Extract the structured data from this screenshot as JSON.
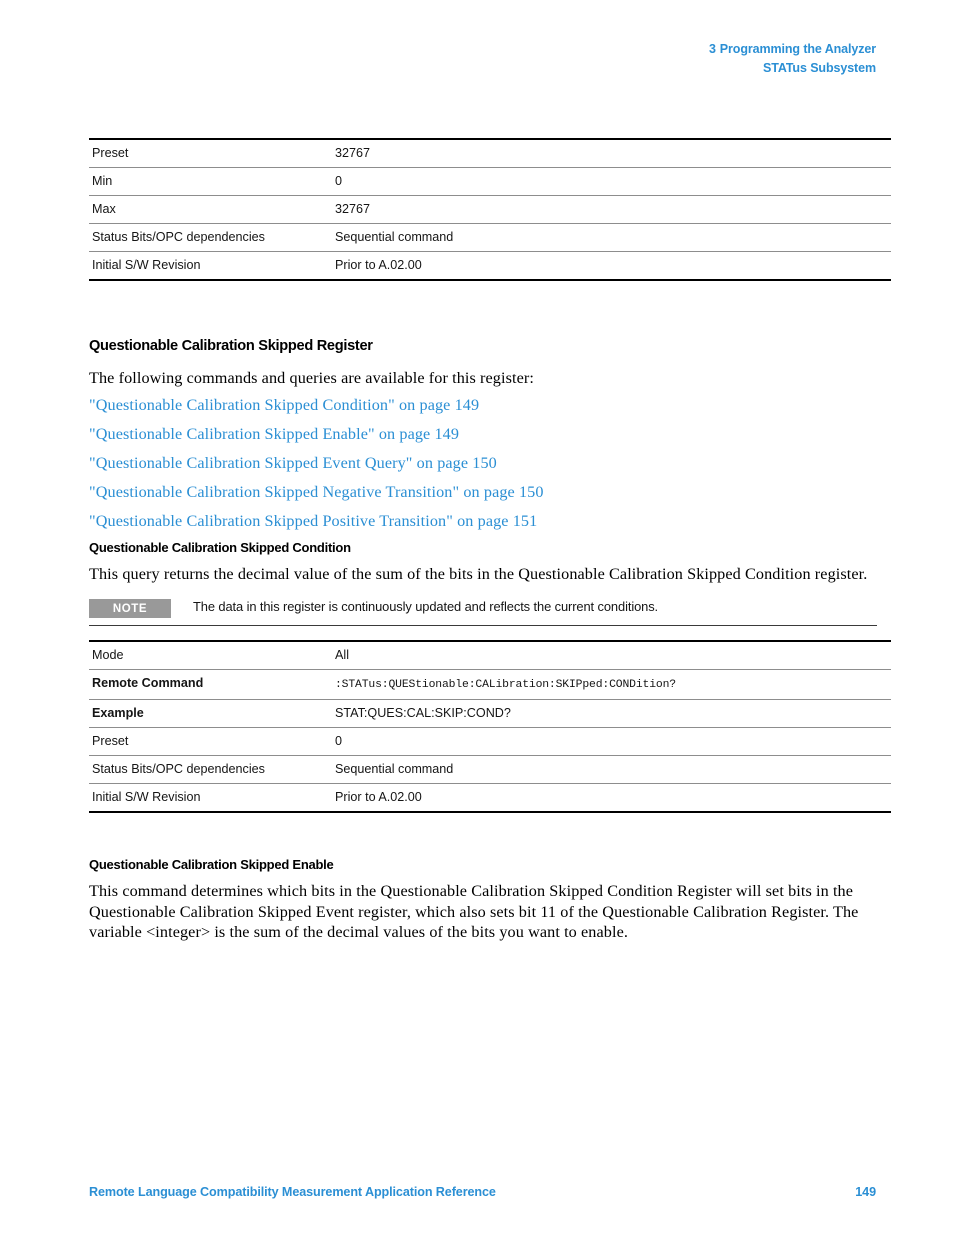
{
  "header": {
    "chapter_number": "3",
    "chapter_title": "Programming the Analyzer",
    "subsystem": "STATus Subsystem",
    "color": "#2b8fd4"
  },
  "top_table": {
    "rows": [
      {
        "key": "Preset",
        "value": "32767"
      },
      {
        "key": "Min",
        "value": "0"
      },
      {
        "key": "Max",
        "value": "32767"
      },
      {
        "key": "Status Bits/OPC dependencies",
        "value": "Sequential command"
      },
      {
        "key": "Initial S/W Revision",
        "value": "Prior to A.02.00"
      }
    ]
  },
  "register_section": {
    "heading": "Questionable Calibration Skipped Register",
    "intro": "The following commands and queries are available for this register:",
    "links": [
      "\"Questionable Calibration Skipped Condition\" on page 149",
      "\"Questionable Calibration Skipped Enable\" on page 149",
      "\"Questionable Calibration Skipped Event Query\" on page 150",
      "\"Questionable Calibration Skipped Negative Transition\" on page 150",
      "\"Questionable Calibration Skipped Positive Transition\" on page 151"
    ]
  },
  "condition_section": {
    "heading": "Questionable Calibration Skipped Condition",
    "description": "This query returns the decimal value of the sum of the bits in the Questionable Calibration Skipped Condition register.",
    "note": {
      "badge": "NOTE",
      "text": "The data in this register is continuously updated and reflects the current conditions."
    },
    "table": {
      "rows": [
        {
          "key": "Mode",
          "value": "All",
          "key_bold": false,
          "value_mono": false
        },
        {
          "key": "Remote Command",
          "value": ":STATus:QUEStionable:CALibration:SKIPped:CONDition?",
          "key_bold": true,
          "value_mono": true
        },
        {
          "key": "Example",
          "value": "STAT:QUES:CAL:SKIP:COND?",
          "key_bold": true,
          "value_mono": false
        },
        {
          "key": "Preset",
          "value": "0",
          "key_bold": false,
          "value_mono": false
        },
        {
          "key": "Status Bits/OPC dependencies",
          "value": "Sequential command",
          "key_bold": false,
          "value_mono": false
        },
        {
          "key": "Initial S/W Revision",
          "value": "Prior to A.02.00",
          "key_bold": false,
          "value_mono": false
        }
      ]
    }
  },
  "enable_section": {
    "heading": "Questionable Calibration Skipped Enable",
    "description": "This command determines which bits in the Questionable Calibration Skipped Condition Register will set bits in the Questionable Calibration Skipped Event register, which also sets bit 11 of the Questionable Calibration Register. The variable <integer> is the sum of the decimal values of the bits you want to enable."
  },
  "footer": {
    "title": "Remote Language Compatibility Measurement Application Reference",
    "page_number": "149"
  }
}
